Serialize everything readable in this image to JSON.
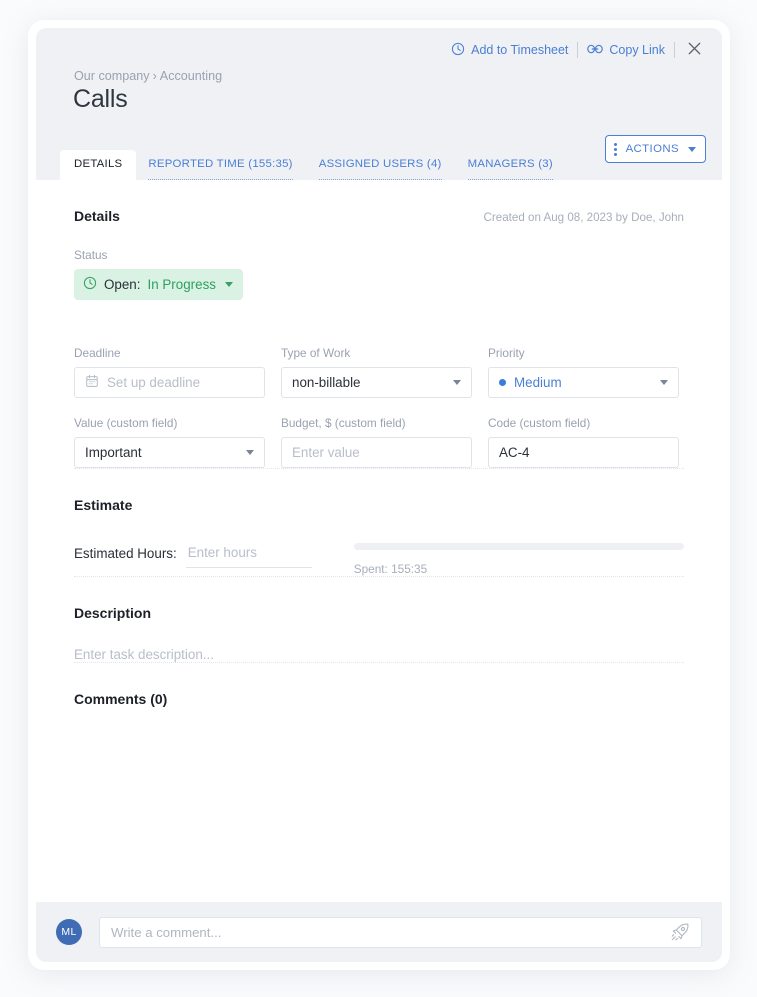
{
  "header": {
    "add_to_timesheet": "Add to Timesheet",
    "copy_link": "Copy Link",
    "breadcrumb_company": "Our company",
    "breadcrumb_chevron": "›",
    "breadcrumb_section": "Accounting",
    "title": "Calls"
  },
  "tabs": [
    {
      "label": "DETAILS",
      "active": true
    },
    {
      "label": "REPORTED TIME (155:35)",
      "active": false
    },
    {
      "label": "ASSIGNED USERS (4)",
      "active": false
    },
    {
      "label": "MANAGERS (3)",
      "active": false
    }
  ],
  "actions_button": {
    "label": "ACTIONS"
  },
  "details": {
    "section_title": "Details",
    "created_on": "Created on Aug 08, 2023 by Doe, John",
    "status_label": "Status",
    "status_prefix": "Open:",
    "status_value": "In Progress",
    "fields_row1": [
      {
        "label": "Deadline",
        "value": "",
        "placeholder": "Set up deadline",
        "type": "date"
      },
      {
        "label": "Type of Work",
        "value": "non-billable",
        "placeholder": "",
        "type": "select"
      },
      {
        "label": "Priority",
        "value": "Medium",
        "placeholder": "",
        "type": "select-dot"
      }
    ],
    "fields_row2": [
      {
        "label": "Value (custom field)",
        "value": "Important",
        "placeholder": "",
        "type": "select"
      },
      {
        "label": "Budget, $ (custom field)",
        "value": "",
        "placeholder": "Enter value",
        "type": "text"
      },
      {
        "label": "Code (custom field)",
        "value": "AC-4",
        "placeholder": "",
        "type": "text"
      }
    ]
  },
  "estimate": {
    "section_title": "Estimate",
    "estimated_hours_label": "Estimated Hours:",
    "estimated_hours_placeholder": "Enter hours",
    "estimated_hours_value": "",
    "spent": "Spent: 155:35",
    "progress_percent": 0
  },
  "description": {
    "section_title": "Description",
    "placeholder": "Enter task description..."
  },
  "comments": {
    "section_title": "Comments (0)",
    "avatar_initials": "ML",
    "input_placeholder": "Write a comment..."
  },
  "colors": {
    "accent_blue": "#4a7fd4",
    "status_green": "#2f9e62",
    "status_green_bg": "#d9f2e3",
    "priority_blue": "#3b7ddd",
    "header_bg": "#eff1f5",
    "avatar_bg": "#3f6cb5"
  }
}
